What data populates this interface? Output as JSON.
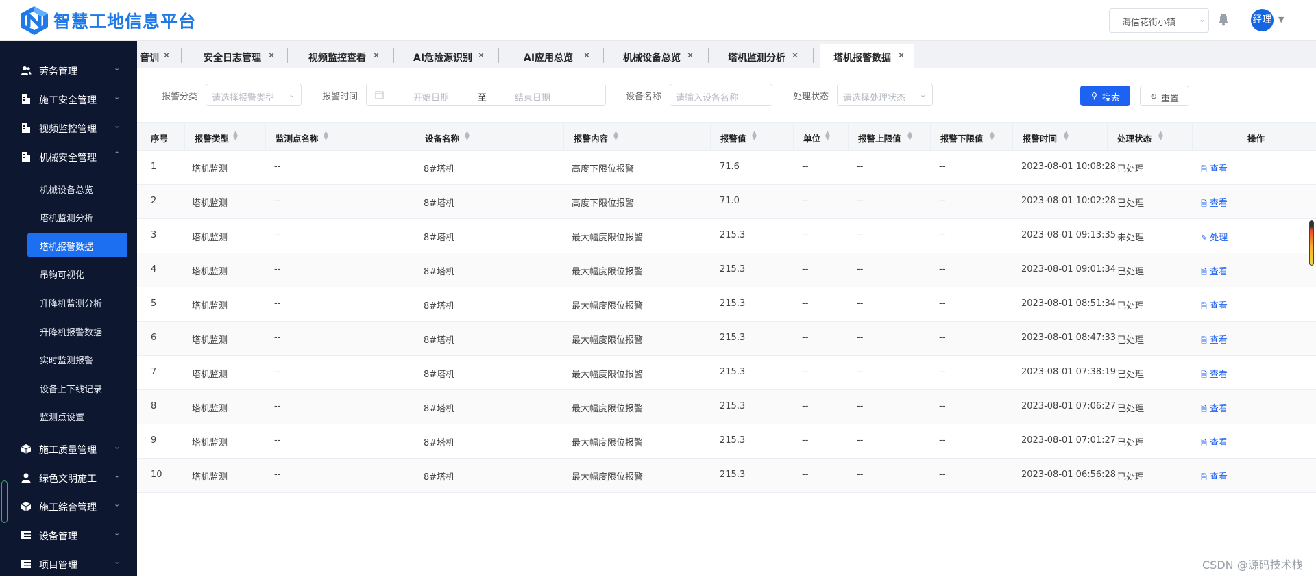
{
  "header": {
    "title": "智慧工地信息平台",
    "project": "海信花街小镇",
    "user_avatar": "经理"
  },
  "sidebar": {
    "items": [
      {
        "label": "劳务管理",
        "icon": "people-icon"
      },
      {
        "label": "施工安全管理",
        "icon": "building-icon"
      },
      {
        "label": "视频监控管理",
        "icon": "building-icon"
      },
      {
        "label": "机械安全管理",
        "icon": "building-icon",
        "expanded": true
      }
    ],
    "subitems": [
      {
        "label": "机械设备总览"
      },
      {
        "label": "塔机监测分析"
      },
      {
        "label": "塔机报警数据",
        "active": true
      },
      {
        "label": "吊钩可视化"
      },
      {
        "label": "升降机监测分析"
      },
      {
        "label": "升降机报警数据"
      },
      {
        "label": "实时监测报警"
      },
      {
        "label": "设备上下线记录"
      },
      {
        "label": "监测点设置"
      }
    ],
    "items_bottom": [
      {
        "label": "施工质量管理",
        "icon": "cube-icon"
      },
      {
        "label": "绿色文明施工",
        "icon": "person-icon"
      },
      {
        "label": "施工综合管理",
        "icon": "cube-icon"
      },
      {
        "label": "设备管理",
        "icon": "table-icon"
      },
      {
        "label": "项目管理",
        "icon": "table-icon"
      }
    ]
  },
  "tabs": [
    {
      "label": "音训"
    },
    {
      "label": "安全日志管理"
    },
    {
      "label": "视频监控查看"
    },
    {
      "label": "AI危险源识别"
    },
    {
      "label": "AI应用总览"
    },
    {
      "label": "机械设备总览"
    },
    {
      "label": "塔机监测分析"
    },
    {
      "label": "塔机报警数据",
      "active": true
    }
  ],
  "filter": {
    "alarm_type_label": "报警分类",
    "alarm_type_placeholder": "请选择报警类型",
    "alarm_time_label": "报警时间",
    "start_placeholder": "开始日期",
    "range_sep": "至",
    "end_placeholder": "结束日期",
    "device_label": "设备名称",
    "device_placeholder": "请输入设备名称",
    "status_label": "处理状态",
    "status_placeholder": "请选择处理状态",
    "search_label": "搜索",
    "reset_label": "重置"
  },
  "table": {
    "columns": [
      "序号",
      "报警类型",
      "监测点名称",
      "设备名称",
      "报警内容",
      "报警值",
      "单位",
      "报警上限值",
      "报警下限值",
      "报警时间",
      "处理状态",
      "操作"
    ],
    "rows": [
      {
        "no": "1",
        "type": "塔机监测",
        "point": "--",
        "device": "8#塔机",
        "content": "高度下限位报警",
        "value": "71.6",
        "unit": "--",
        "upper": "--",
        "lower": "--",
        "time": "2023-08-01 10:08:28",
        "status": "已处理",
        "action": "查看"
      },
      {
        "no": "2",
        "type": "塔机监测",
        "point": "--",
        "device": "8#塔机",
        "content": "高度下限位报警",
        "value": "71.0",
        "unit": "--",
        "upper": "--",
        "lower": "--",
        "time": "2023-08-01 10:02:28",
        "status": "已处理",
        "action": "查看"
      },
      {
        "no": "3",
        "type": "塔机监测",
        "point": "--",
        "device": "8#塔机",
        "content": "最大幅度限位报警",
        "value": "215.3",
        "unit": "--",
        "upper": "--",
        "lower": "--",
        "time": "2023-08-01 09:13:35",
        "status": "未处理",
        "action": "处理"
      },
      {
        "no": "4",
        "type": "塔机监测",
        "point": "--",
        "device": "8#塔机",
        "content": "最大幅度限位报警",
        "value": "215.3",
        "unit": "--",
        "upper": "--",
        "lower": "--",
        "time": "2023-08-01 09:01:34",
        "status": "已处理",
        "action": "查看"
      },
      {
        "no": "5",
        "type": "塔机监测",
        "point": "--",
        "device": "8#塔机",
        "content": "最大幅度限位报警",
        "value": "215.3",
        "unit": "--",
        "upper": "--",
        "lower": "--",
        "time": "2023-08-01 08:51:34",
        "status": "已处理",
        "action": "查看"
      },
      {
        "no": "6",
        "type": "塔机监测",
        "point": "--",
        "device": "8#塔机",
        "content": "最大幅度限位报警",
        "value": "215.3",
        "unit": "--",
        "upper": "--",
        "lower": "--",
        "time": "2023-08-01 08:47:33",
        "status": "已处理",
        "action": "查看"
      },
      {
        "no": "7",
        "type": "塔机监测",
        "point": "--",
        "device": "8#塔机",
        "content": "最大幅度限位报警",
        "value": "215.3",
        "unit": "--",
        "upper": "--",
        "lower": "--",
        "time": "2023-08-01 07:38:19",
        "status": "已处理",
        "action": "查看"
      },
      {
        "no": "8",
        "type": "塔机监测",
        "point": "--",
        "device": "8#塔机",
        "content": "最大幅度限位报警",
        "value": "215.3",
        "unit": "--",
        "upper": "--",
        "lower": "--",
        "time": "2023-08-01 07:06:27",
        "status": "已处理",
        "action": "查看"
      },
      {
        "no": "9",
        "type": "塔机监测",
        "point": "--",
        "device": "8#塔机",
        "content": "最大幅度限位报警",
        "value": "215.3",
        "unit": "--",
        "upper": "--",
        "lower": "--",
        "time": "2023-08-01 07:01:27",
        "status": "已处理",
        "action": "查看"
      },
      {
        "no": "10",
        "type": "塔机监测",
        "point": "--",
        "device": "8#塔机",
        "content": "最大幅度限位报警",
        "value": "215.3",
        "unit": "--",
        "upper": "--",
        "lower": "--",
        "time": "2023-08-01 06:56:28",
        "status": "已处理",
        "action": "查看"
      }
    ]
  },
  "watermark": "CSDN @源码技术栈",
  "colors": {
    "primary": "#1d62f0",
    "sidebar_bg": "#0e1730",
    "brand": "#1f79e8"
  }
}
